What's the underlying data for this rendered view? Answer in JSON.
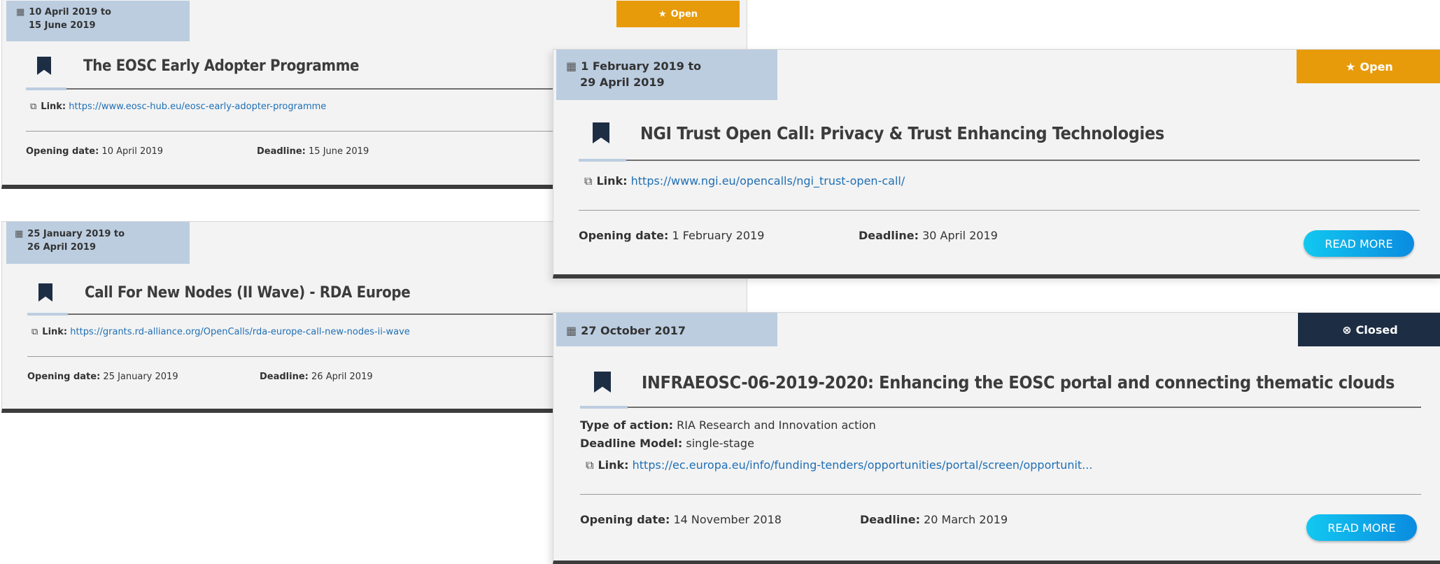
{
  "cards": [
    {
      "id": "eosc",
      "date_line1": "10 April 2019 to",
      "date_line2": "15 June 2019",
      "status": "Open",
      "title": "The EOSC Early Adopter Programme",
      "link_label": "Link:",
      "link_url": "https://www.eosc-hub.eu/eosc-early-adopter-programme",
      "opening_label": "Opening date:",
      "opening_value": "10 April 2019",
      "deadline_label": "Deadline:",
      "deadline_value": "15 June 2019"
    },
    {
      "id": "rda",
      "date_line1": "25 January 2019 to",
      "date_line2": "26 April 2019",
      "title": "Call For New Nodes (II Wave) - RDA Europe",
      "link_label": "Link:",
      "link_url": "https://grants.rd-alliance.org/OpenCalls/rda-europe-call-new-nodes-ii-wave",
      "opening_label": "Opening date:",
      "opening_value": "25 January 2019",
      "deadline_label": "Deadline:",
      "deadline_value": "26 April 2019"
    },
    {
      "id": "ngi",
      "date_line1": "1 February 2019 to",
      "date_line2": "29 April 2019",
      "status": "Open",
      "title": "NGI Trust Open Call: Privacy & Trust Enhancing Technologies",
      "link_label": "Link:",
      "link_url": "https://www.ngi.eu/opencalls/ngi_trust-open-call/",
      "opening_label": "Opening date:",
      "opening_value": "1 February 2019",
      "deadline_label": "Deadline:",
      "deadline_value": "30 April 2019",
      "button": "READ MORE"
    },
    {
      "id": "infra",
      "date_line1": "27 October 2017",
      "status": "Closed",
      "title": "INFRAEOSC-06-2019-2020: Enhancing the EOSC portal and connecting thematic clouds",
      "type_label": "Type of action:",
      "type_value": "RIA Research and Innovation action",
      "model_label": "Deadline Model:",
      "model_value": "single-stage",
      "link_label": "Link:",
      "link_url": "https://ec.europa.eu/info/funding-tenders/opportunities/portal/screen/opportunit...",
      "opening_label": "Opening date:",
      "opening_value": "14 November 2018",
      "deadline_label": "Deadline:",
      "deadline_value": "20 March 2019",
      "button": "READ MORE"
    }
  ],
  "icons": {
    "calendar": "calendar-icon",
    "star": "star-icon",
    "closed": "x-circle-icon",
    "bookmark": "bookmark-icon",
    "external": "external-link-icon"
  },
  "colors": {
    "open": "#e89b0a",
    "closed": "#1d2d44",
    "date_bg": "#bccde0",
    "link": "#1f6fb5",
    "button": "#0ab0ec"
  }
}
